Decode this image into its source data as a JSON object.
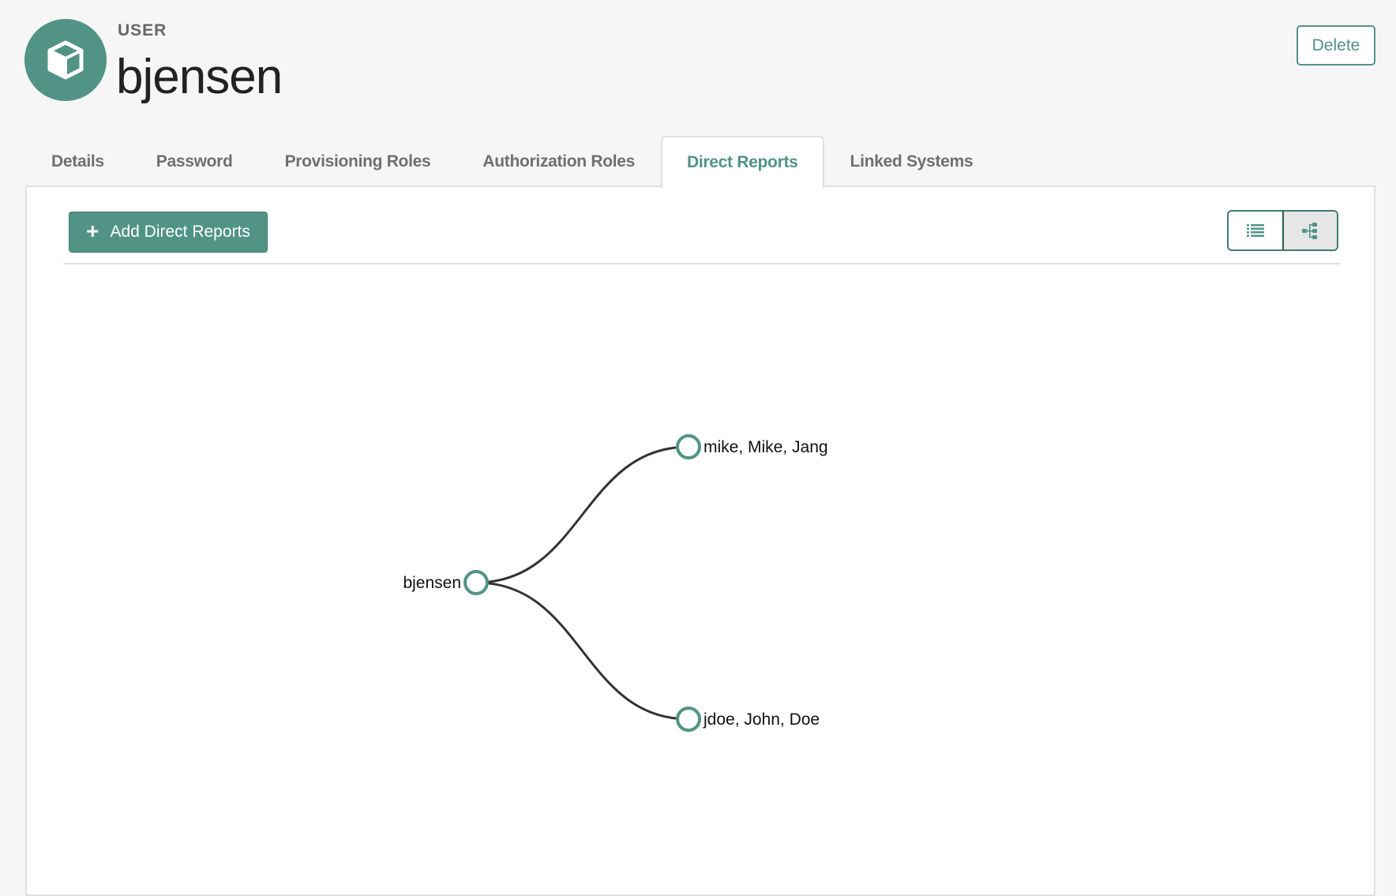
{
  "header": {
    "type_label": "USER",
    "title": "bjensen",
    "avatar_icon": "cube-icon",
    "delete_label": "Delete"
  },
  "tabs": [
    {
      "label": "Details",
      "active": false
    },
    {
      "label": "Password",
      "active": false
    },
    {
      "label": "Provisioning Roles",
      "active": false
    },
    {
      "label": "Authorization Roles",
      "active": false
    },
    {
      "label": "Direct Reports",
      "active": true
    },
    {
      "label": "Linked Systems",
      "active": false
    }
  ],
  "toolbar": {
    "add_label": "Add Direct Reports",
    "add_icon": "plus-icon",
    "view_options": [
      {
        "name": "list-view",
        "icon": "list-icon",
        "active": false
      },
      {
        "name": "tree-view",
        "icon": "org-tree-icon",
        "active": true
      }
    ]
  },
  "colors": {
    "accent": "#519485",
    "link": "#333333",
    "background": "#f6f6f6"
  },
  "tree": {
    "root": {
      "label": "bjensen"
    },
    "children": [
      {
        "label": "mike, Mike, Jang"
      },
      {
        "label": "jdoe, John, Doe"
      }
    ]
  }
}
